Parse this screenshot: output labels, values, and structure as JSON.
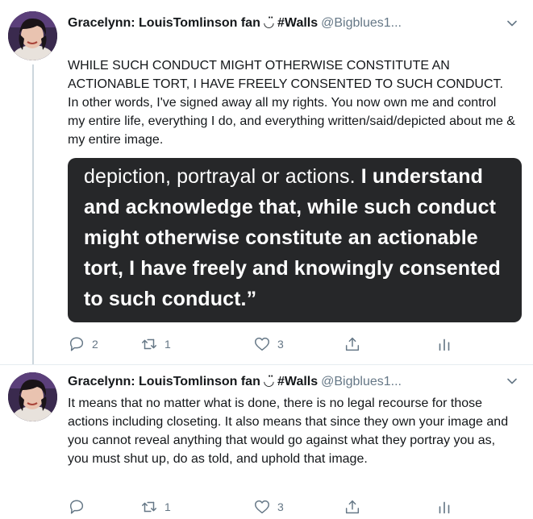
{
  "tweets": [
    {
      "author_name": "Gracelynn: LouisTomlinson fan ◡̈ #Walls",
      "handle": "@Bigblues1...",
      "text": "WHILE SUCH CONDUCT MIGHT OTHERWISE CONSTITUTE AN ACTIONABLE TORT, I HAVE FREELY CONSENTED TO SUCH CONDUCT. In other words, I've signed away all my rights. You now own me and control my entire life, everything I do, and everything written/said/depicted about me & my entire image.",
      "media_text_pre": "depiction, portrayal or actions. ",
      "media_text_bold": "I understand and acknowledge that, while such conduct might otherwise constitute an actionable tort, I have freely and knowingly consented to such conduct.”",
      "reply_count": "2",
      "retweet_count": "1",
      "like_count": "3",
      "icons": [
        "reply-icon",
        "retweet-icon",
        "like-icon",
        "share-icon",
        "analytics-icon",
        "chevron-down-icon"
      ]
    },
    {
      "author_name": "Gracelynn: LouisTomlinson fan ◡̈ #Walls",
      "handle": "@Bigblues1...",
      "text": "It means that no matter what is done, there is no legal recourse for those actions including closeting. It also means that since they own your image and you cannot reveal anything that would go against what they portray you as, you must shut up, do as told, and uphold that image.",
      "reply_count": "",
      "retweet_count": "1",
      "like_count": "3",
      "icons": [
        "reply-icon",
        "retweet-icon",
        "like-icon",
        "share-icon",
        "analytics-icon",
        "chevron-down-icon"
      ]
    }
  ],
  "colors": {
    "text_primary": "#14171a",
    "text_secondary": "#657786",
    "media_background": "#262729",
    "divider": "#e6ecf0"
  }
}
